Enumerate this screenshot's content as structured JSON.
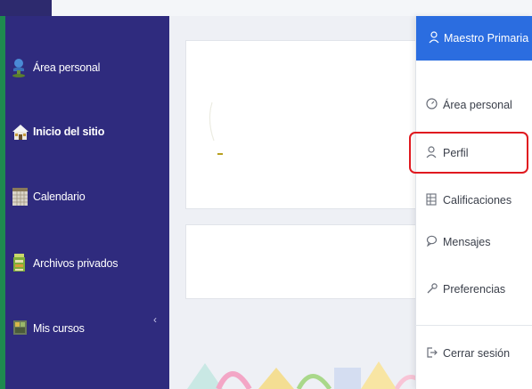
{
  "sidebar": {
    "items": [
      {
        "label": "Área personal",
        "icon": "person-pin-icon"
      },
      {
        "label": "Inicio del sitio",
        "icon": "home-icon"
      },
      {
        "label": "Calendario",
        "icon": "calendar-icon"
      },
      {
        "label": "Archivos privados",
        "icon": "folder-icon"
      },
      {
        "label": "Mis cursos",
        "icon": "courses-icon"
      }
    ],
    "collapse_glyph": "‹"
  },
  "user_menu": {
    "username": "Maestro Primaria",
    "items": [
      {
        "label": "Área personal",
        "icon": "dashboard-icon"
      },
      {
        "label": "Perfil",
        "icon": "user-icon"
      },
      {
        "label": "Calificaciones",
        "icon": "grades-icon"
      },
      {
        "label": "Mensajes",
        "icon": "chat-icon"
      },
      {
        "label": "Preferencias",
        "icon": "wrench-icon"
      }
    ],
    "logout_label": "Cerrar sesión",
    "highlighted_item": "Perfil",
    "highlight_color": "#e0191f",
    "header_color": "#2b6de0"
  },
  "colors": {
    "sidebar_bg": "#2f2b7e",
    "accent_green": "#1e8a4f"
  }
}
